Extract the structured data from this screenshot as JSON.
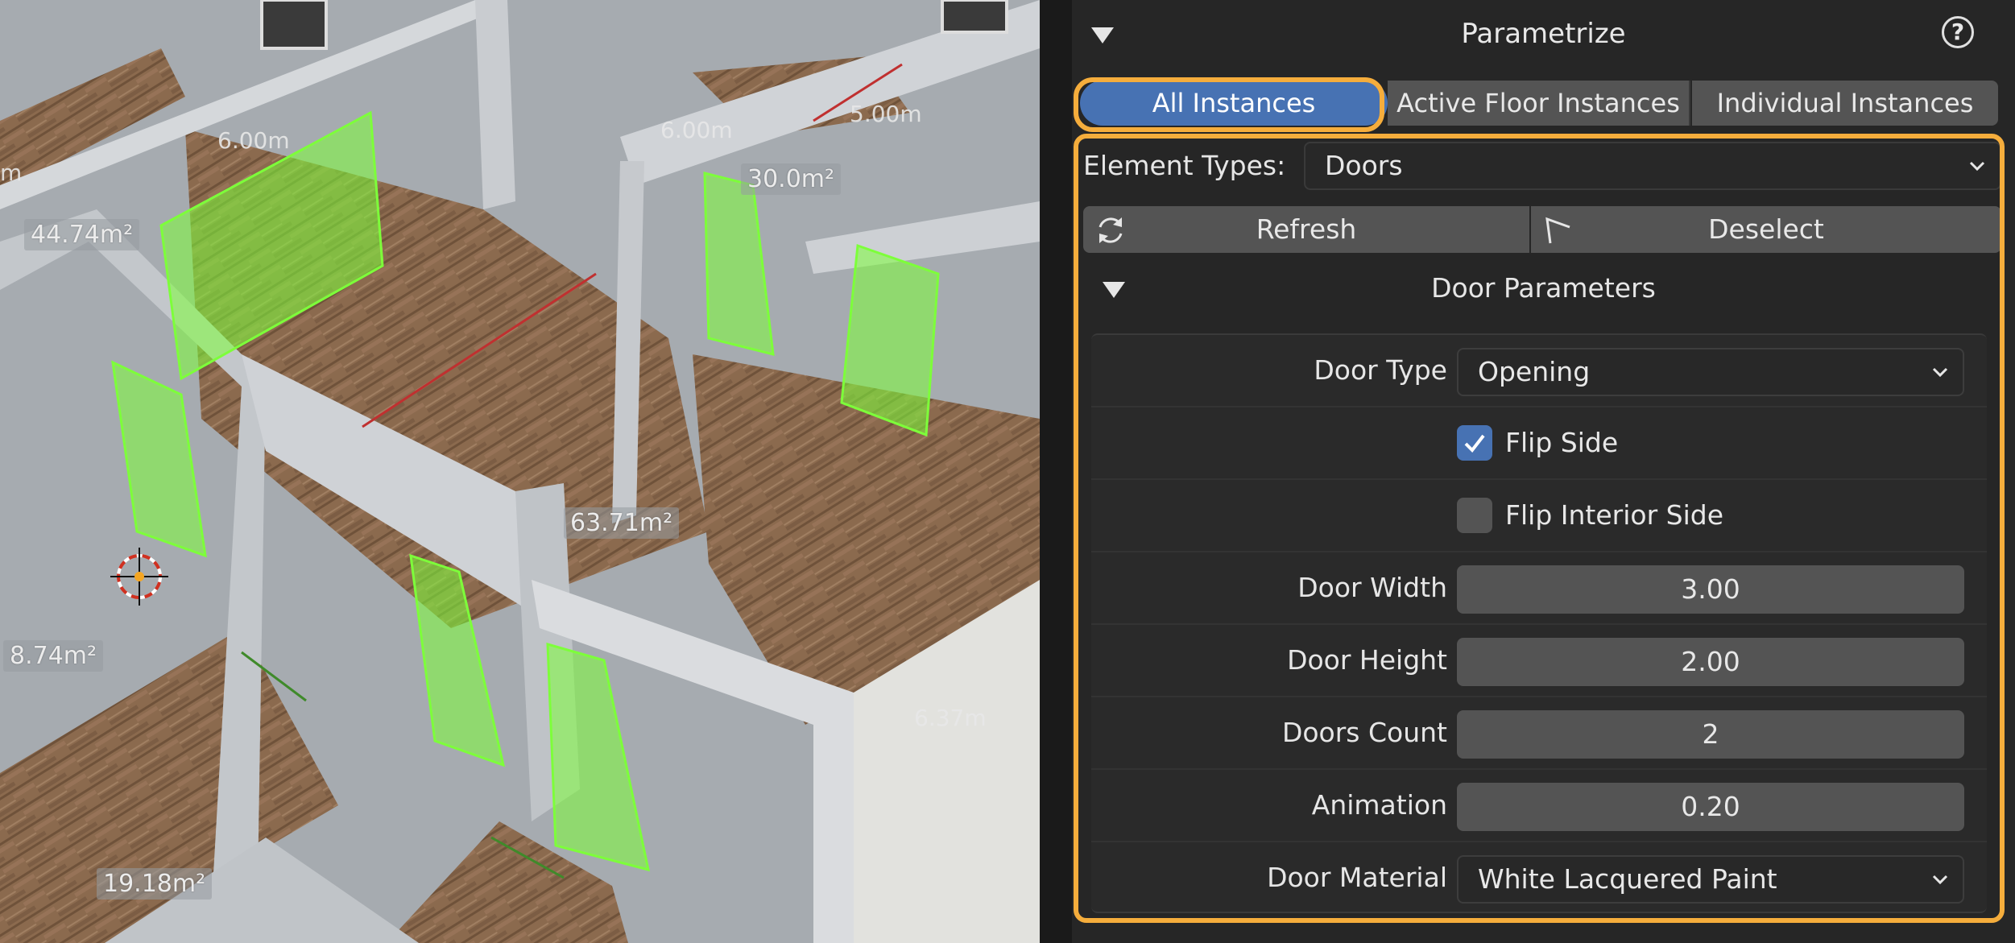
{
  "viewport": {
    "area_labels": [
      "44.74m²",
      "30.0m²",
      "63.71m²",
      "8.74m²",
      "19.18m²"
    ],
    "dimension_labels": [
      "6.00m",
      "6.00m",
      "5.00m",
      "m",
      "6.37m"
    ]
  },
  "panel": {
    "title": "Parametrize",
    "help_glyph": "?",
    "tabs": [
      {
        "label": "All Instances",
        "active": true
      },
      {
        "label": "Active Floor Instances",
        "active": false
      },
      {
        "label": "Individual Instances",
        "active": false
      }
    ],
    "element_types_label": "Element Types:",
    "element_types_value": "Doors",
    "refresh_label": "Refresh",
    "deselect_label": "Deselect",
    "door_params": {
      "title": "Door Parameters",
      "door_type_label": "Door Type",
      "door_type_value": "Opening",
      "flip_side_label": "Flip Side",
      "flip_side_checked": true,
      "flip_interior_label": "Flip Interior Side",
      "flip_interior_checked": false,
      "door_width_label": "Door Width",
      "door_width_value": "3.00",
      "door_height_label": "Door Height",
      "door_height_value": "2.00",
      "doors_count_label": "Doors Count",
      "doors_count_value": "2",
      "animation_label": "Animation",
      "animation_value": "0.20",
      "door_material_label": "Door Material",
      "door_material_value": "White Lacquered Paint"
    }
  },
  "colors": {
    "accent_blue": "#4772b3",
    "highlight_orange": "#f5ad3c",
    "selection_green": "#7dff3a",
    "panel_bg": "#262626"
  }
}
